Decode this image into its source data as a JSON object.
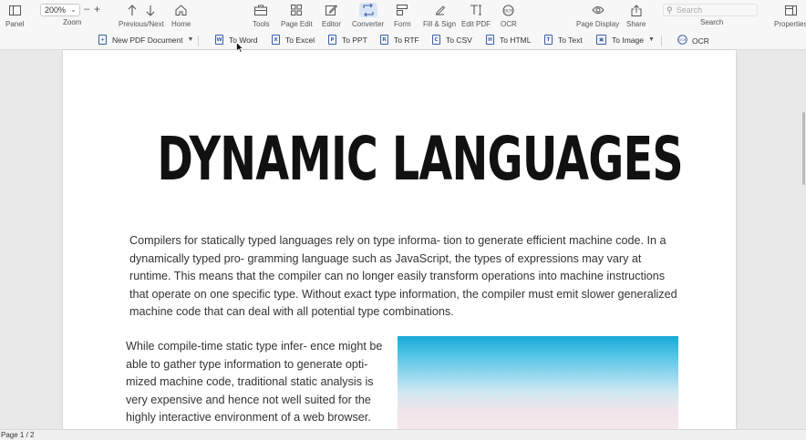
{
  "toolbar": {
    "panel": "Panel",
    "zoom_value": "200%",
    "zoom_label": "Zoom",
    "prev_next": "Previous/Next",
    "home": "Home",
    "tools": "Tools",
    "page_edit": "Page Edit",
    "editor": "Editor",
    "converter": "Converter",
    "form": "Form",
    "fill_sign": "Fill & Sign",
    "edit_pdf": "Edit PDF",
    "ocr": "OCR",
    "page_display": "Page Display",
    "share": "Share",
    "search_placeholder": "Search",
    "search_label": "Search",
    "properties": "Properties"
  },
  "converter_bar": {
    "new_pdf": "New PDF Document",
    "to_word": "To Word",
    "to_excel": "To Excel",
    "to_ppt": "To PPT",
    "to_rtf": "To RTF",
    "to_csv": "To CSV",
    "to_html": "To HTML",
    "to_text": "To Text",
    "to_image": "To Image",
    "ocr": "OCR"
  },
  "document": {
    "title": "DYNAMIC LANGUAGES",
    "paragraph1": "Compilers for statically typed languages rely on type informa- tion to generate efficient machine code. In a dynamically typed pro- gramming language such as JavaScript, the types of expressions may vary at runtime. This means that the compiler can no longer easily transform operations into machine instructions that operate on one specific type. Without exact type information, the compiler must emit slower generalized machine code that can deal with all potential type combinations.",
    "paragraph2": "While compile-time static type infer- ence might be able to gather type information to generate opti- mized machine code, traditional static analysis is very expensive and hence not well suited for the highly interactive environment of a web browser."
  },
  "status": {
    "page_indicator": "Page 1 / 2"
  },
  "colors": {
    "accent": "#3a5fa8",
    "active_tab_bg": "#dbe6f5"
  }
}
